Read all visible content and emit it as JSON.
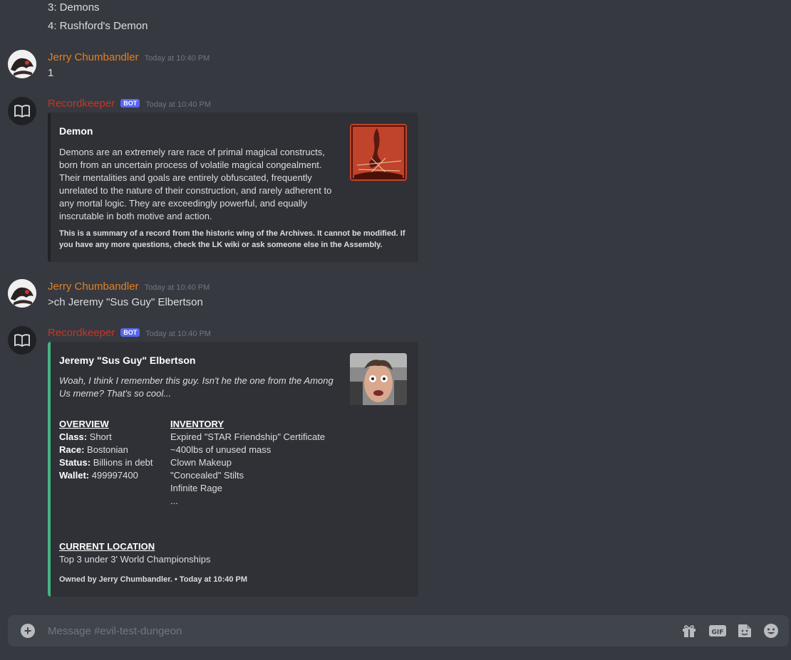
{
  "previous_lines": [
    "3: Demons",
    "4: Rushford's Demon"
  ],
  "messages": [
    {
      "author": "Jerry Chumbandler",
      "timestamp": "Today at 10:40 PM",
      "text": "1"
    },
    {
      "author": "Recordkeeper",
      "bot_tag": "BOT",
      "timestamp": "Today at 10:40 PM",
      "embed": {
        "title": "Demon",
        "description": "Demons are an extremely rare race of primal magical constructs, born from an uncertain process of volatile magical congealment. Their mentalities and goals are entirely obfuscated, frequently unrelated to the nature of their construction, and rarely adherent to any mortal logic. They are exceedingly powerful, and equally inscrutable in both motive and action.",
        "footer": "This is a summary of a record from the historic wing of the Archives. It cannot be modified. If you have any more questions, check the LK wiki or ask someone else in the Assembly.",
        "accent_color": "#202225"
      }
    },
    {
      "author": "Jerry Chumbandler",
      "timestamp": "Today at 10:40 PM",
      "text": ">ch Jeremy \"Sus Guy\" Elbertson"
    },
    {
      "author": "Recordkeeper",
      "bot_tag": "BOT",
      "timestamp": "Today at 10:40 PM",
      "embed": {
        "title": "Jeremy \"Sus Guy\" Elbertson",
        "description": "Woah, I think I remember this guy. Isn't he the one from the Among Us meme? That's so cool...",
        "accent_color": "#43b581",
        "overview": {
          "name": "OVERVIEW",
          "rows": [
            {
              "label": "Class:",
              "value": "Short"
            },
            {
              "label": "Race:",
              "value": "Bostonian"
            },
            {
              "label": "Status:",
              "value": "Billions in debt"
            },
            {
              "label": "Wallet:",
              "value": "499997400"
            }
          ]
        },
        "inventory": {
          "name": "INVENTORY",
          "items": [
            "Expired \"STAR Friendship\" Certificate",
            "~400lbs of unused mass",
            "Clown Makeup",
            "\"Concealed\" Stilts",
            "Infinite Rage",
            "..."
          ]
        },
        "location": {
          "name": "CURRENT LOCATION",
          "value": "Top 3 under 3' World Championships"
        },
        "footer": "Owned by Jerry Chumbandler. • Today at 10:40 PM"
      }
    }
  ],
  "composer": {
    "placeholder": "Message #evil-test-dungeon"
  },
  "icons": [
    "plus-icon",
    "gift-icon",
    "gif-icon",
    "sticker-icon",
    "emoji-icon"
  ]
}
